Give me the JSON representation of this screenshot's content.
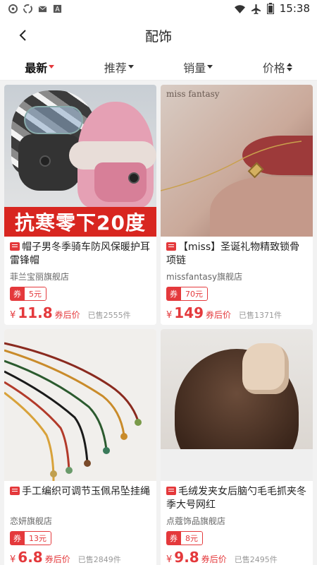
{
  "status_bar": {
    "time": "15:38"
  },
  "header": {
    "title": "配饰"
  },
  "sort_tabs": [
    {
      "label": "最新"
    },
    {
      "label": "推荐"
    },
    {
      "label": "销量"
    },
    {
      "label": "价格"
    }
  ],
  "products": [
    {
      "image_text": "抗寒零下20度",
      "title": "帽子男冬季骑车防风保暖护耳雷锋帽",
      "shop": "菲兰宝丽旗舰店",
      "coupon_label": "券",
      "coupon_amount": "5元",
      "price_symbol": "¥",
      "price": "11.8",
      "price_note": "券后价",
      "sold": "已售2555件"
    },
    {
      "image_text": "miss fantasy",
      "title": "【miss】圣诞礼物精致锁骨项链",
      "shop": "missfantasy旗舰店",
      "coupon_label": "券",
      "coupon_amount": "70元",
      "price_symbol": "¥",
      "price": "149",
      "price_note": "券后价",
      "sold": "已售1371件"
    },
    {
      "title": "手工编织可调节玉佩吊坠挂绳",
      "shop": "恋妍旗舰店",
      "coupon_label": "券",
      "coupon_amount": "13元",
      "price_symbol": "¥",
      "price": "6.8",
      "price_note": "券后价",
      "sold": "已售2849件"
    },
    {
      "title": "毛绒发夹女后脑勺毛毛抓夹冬季大号网红",
      "shop": "点蔻饰品旗舰店",
      "coupon_label": "券",
      "coupon_amount": "8元",
      "price_symbol": "¥",
      "price": "9.8",
      "price_note": "券后价",
      "sold": "已售2495件"
    }
  ],
  "colors": {
    "accent": "#e4393c",
    "banner": "#d82620"
  }
}
